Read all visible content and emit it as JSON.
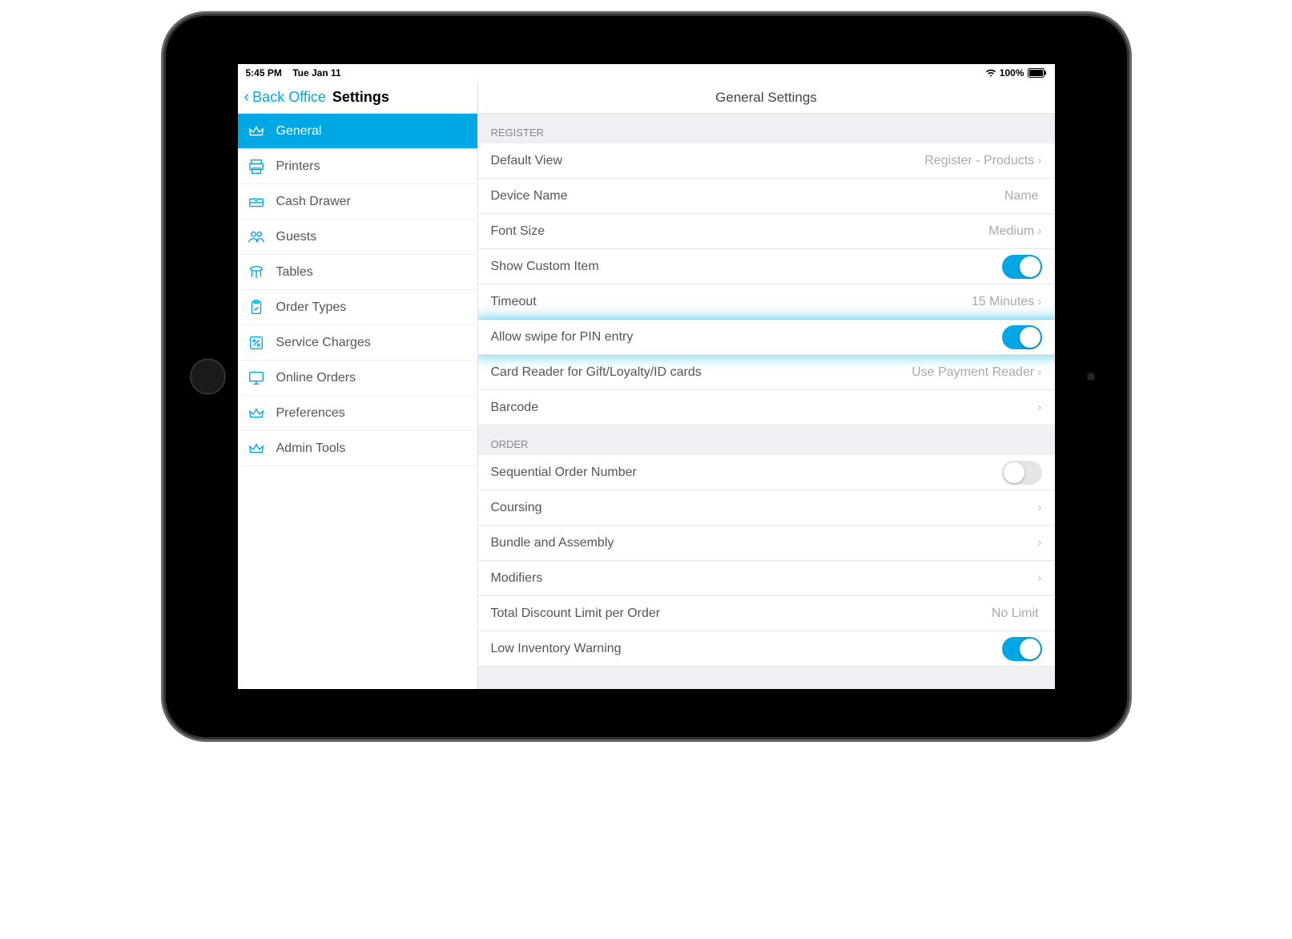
{
  "status": {
    "time": "5:45 PM",
    "date": "Tue Jan 11",
    "battery": "100%"
  },
  "header": {
    "back": "Back Office",
    "title": "Settings"
  },
  "sidebar": {
    "items": [
      {
        "label": "General",
        "icon": "crown",
        "active": true
      },
      {
        "label": "Printers",
        "icon": "printer"
      },
      {
        "label": "Cash Drawer",
        "icon": "drawer"
      },
      {
        "label": "Guests",
        "icon": "people"
      },
      {
        "label": "Tables",
        "icon": "table"
      },
      {
        "label": "Order Types",
        "icon": "clipboard"
      },
      {
        "label": "Service Charges",
        "icon": "percent"
      },
      {
        "label": "Online Orders",
        "icon": "monitor"
      },
      {
        "label": "Preferences",
        "icon": "crown2"
      },
      {
        "label": "Admin Tools",
        "icon": "crown3"
      }
    ]
  },
  "main": {
    "title": "General Settings",
    "sections": [
      {
        "header": "REGISTER",
        "rows": [
          {
            "label": "Default View",
            "value": "Register - Products",
            "type": "nav"
          },
          {
            "label": "Device Name",
            "value": "Name",
            "type": "text"
          },
          {
            "label": "Font Size",
            "value": "Medium",
            "type": "nav"
          },
          {
            "label": "Show Custom Item",
            "type": "toggle",
            "on": true,
            "highlight": false
          },
          {
            "label": "Timeout",
            "value": "15 Minutes",
            "type": "nav"
          },
          {
            "label": "Allow swipe for PIN entry",
            "type": "toggle",
            "on": true,
            "highlight": true
          },
          {
            "label": "Card Reader for Gift/Loyalty/ID cards",
            "value": "Use Payment Reader",
            "type": "nav"
          },
          {
            "label": "Barcode",
            "value": "",
            "type": "nav"
          }
        ]
      },
      {
        "header": "ORDER",
        "rows": [
          {
            "label": "Sequential Order Number",
            "type": "toggle",
            "on": false
          },
          {
            "label": "Coursing",
            "value": "",
            "type": "nav"
          },
          {
            "label": "Bundle and Assembly",
            "value": "",
            "type": "nav"
          },
          {
            "label": "Modifiers",
            "value": "",
            "type": "nav"
          },
          {
            "label": "Total Discount Limit per Order",
            "value": "No Limit",
            "type": "text"
          },
          {
            "label": "Low Inventory Warning",
            "type": "toggle",
            "on": true
          }
        ]
      }
    ]
  }
}
